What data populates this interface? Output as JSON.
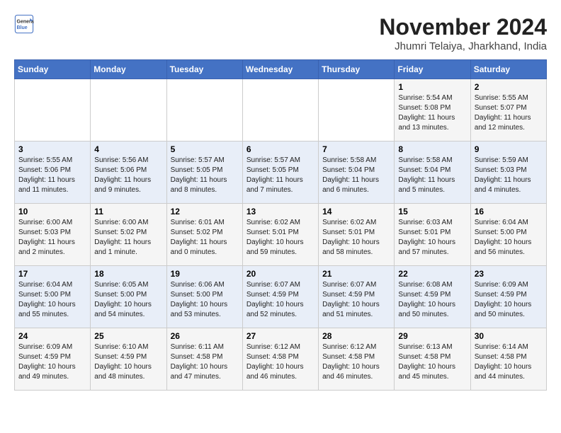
{
  "logo": {
    "line1": "General",
    "line2": "Blue"
  },
  "title": "November 2024",
  "subtitle": "Jhumri Telaiya, Jharkhand, India",
  "headers": [
    "Sunday",
    "Monday",
    "Tuesday",
    "Wednesday",
    "Thursday",
    "Friday",
    "Saturday"
  ],
  "weeks": [
    [
      {
        "day": "",
        "info": ""
      },
      {
        "day": "",
        "info": ""
      },
      {
        "day": "",
        "info": ""
      },
      {
        "day": "",
        "info": ""
      },
      {
        "day": "",
        "info": ""
      },
      {
        "day": "1",
        "info": "Sunrise: 5:54 AM\nSunset: 5:08 PM\nDaylight: 11 hours and 13 minutes."
      },
      {
        "day": "2",
        "info": "Sunrise: 5:55 AM\nSunset: 5:07 PM\nDaylight: 11 hours and 12 minutes."
      }
    ],
    [
      {
        "day": "3",
        "info": "Sunrise: 5:55 AM\nSunset: 5:06 PM\nDaylight: 11 hours and 11 minutes."
      },
      {
        "day": "4",
        "info": "Sunrise: 5:56 AM\nSunset: 5:06 PM\nDaylight: 11 hours and 9 minutes."
      },
      {
        "day": "5",
        "info": "Sunrise: 5:57 AM\nSunset: 5:05 PM\nDaylight: 11 hours and 8 minutes."
      },
      {
        "day": "6",
        "info": "Sunrise: 5:57 AM\nSunset: 5:05 PM\nDaylight: 11 hours and 7 minutes."
      },
      {
        "day": "7",
        "info": "Sunrise: 5:58 AM\nSunset: 5:04 PM\nDaylight: 11 hours and 6 minutes."
      },
      {
        "day": "8",
        "info": "Sunrise: 5:58 AM\nSunset: 5:04 PM\nDaylight: 11 hours and 5 minutes."
      },
      {
        "day": "9",
        "info": "Sunrise: 5:59 AM\nSunset: 5:03 PM\nDaylight: 11 hours and 4 minutes."
      }
    ],
    [
      {
        "day": "10",
        "info": "Sunrise: 6:00 AM\nSunset: 5:03 PM\nDaylight: 11 hours and 2 minutes."
      },
      {
        "day": "11",
        "info": "Sunrise: 6:00 AM\nSunset: 5:02 PM\nDaylight: 11 hours and 1 minute."
      },
      {
        "day": "12",
        "info": "Sunrise: 6:01 AM\nSunset: 5:02 PM\nDaylight: 11 hours and 0 minutes."
      },
      {
        "day": "13",
        "info": "Sunrise: 6:02 AM\nSunset: 5:01 PM\nDaylight: 10 hours and 59 minutes."
      },
      {
        "day": "14",
        "info": "Sunrise: 6:02 AM\nSunset: 5:01 PM\nDaylight: 10 hours and 58 minutes."
      },
      {
        "day": "15",
        "info": "Sunrise: 6:03 AM\nSunset: 5:01 PM\nDaylight: 10 hours and 57 minutes."
      },
      {
        "day": "16",
        "info": "Sunrise: 6:04 AM\nSunset: 5:00 PM\nDaylight: 10 hours and 56 minutes."
      }
    ],
    [
      {
        "day": "17",
        "info": "Sunrise: 6:04 AM\nSunset: 5:00 PM\nDaylight: 10 hours and 55 minutes."
      },
      {
        "day": "18",
        "info": "Sunrise: 6:05 AM\nSunset: 5:00 PM\nDaylight: 10 hours and 54 minutes."
      },
      {
        "day": "19",
        "info": "Sunrise: 6:06 AM\nSunset: 5:00 PM\nDaylight: 10 hours and 53 minutes."
      },
      {
        "day": "20",
        "info": "Sunrise: 6:07 AM\nSunset: 4:59 PM\nDaylight: 10 hours and 52 minutes."
      },
      {
        "day": "21",
        "info": "Sunrise: 6:07 AM\nSunset: 4:59 PM\nDaylight: 10 hours and 51 minutes."
      },
      {
        "day": "22",
        "info": "Sunrise: 6:08 AM\nSunset: 4:59 PM\nDaylight: 10 hours and 50 minutes."
      },
      {
        "day": "23",
        "info": "Sunrise: 6:09 AM\nSunset: 4:59 PM\nDaylight: 10 hours and 50 minutes."
      }
    ],
    [
      {
        "day": "24",
        "info": "Sunrise: 6:09 AM\nSunset: 4:59 PM\nDaylight: 10 hours and 49 minutes."
      },
      {
        "day": "25",
        "info": "Sunrise: 6:10 AM\nSunset: 4:59 PM\nDaylight: 10 hours and 48 minutes."
      },
      {
        "day": "26",
        "info": "Sunrise: 6:11 AM\nSunset: 4:58 PM\nDaylight: 10 hours and 47 minutes."
      },
      {
        "day": "27",
        "info": "Sunrise: 6:12 AM\nSunset: 4:58 PM\nDaylight: 10 hours and 46 minutes."
      },
      {
        "day": "28",
        "info": "Sunrise: 6:12 AM\nSunset: 4:58 PM\nDaylight: 10 hours and 46 minutes."
      },
      {
        "day": "29",
        "info": "Sunrise: 6:13 AM\nSunset: 4:58 PM\nDaylight: 10 hours and 45 minutes."
      },
      {
        "day": "30",
        "info": "Sunrise: 6:14 AM\nSunset: 4:58 PM\nDaylight: 10 hours and 44 minutes."
      }
    ]
  ]
}
